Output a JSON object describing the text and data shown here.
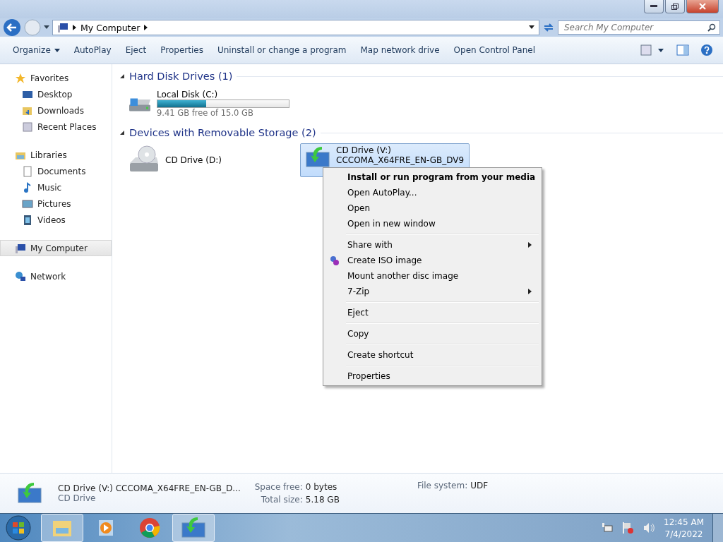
{
  "window": {
    "address": "My Computer",
    "search": {
      "placeholder": "Search My Computer"
    }
  },
  "toolbar": [
    {
      "label": "Organize",
      "dropdown": true
    },
    {
      "label": "AutoPlay",
      "dropdown": false
    },
    {
      "label": "Eject",
      "dropdown": false
    },
    {
      "label": "Properties",
      "dropdown": false
    },
    {
      "label": "Uninstall or change a program",
      "dropdown": false
    },
    {
      "label": "Map network drive",
      "dropdown": false
    },
    {
      "label": "Open Control Panel",
      "dropdown": false
    }
  ],
  "sidebar": {
    "groups": [
      {
        "label": "Favorites",
        "kind": "favorites",
        "selected": false,
        "children": [
          {
            "label": "Desktop",
            "kind": "desktop"
          },
          {
            "label": "Downloads",
            "kind": "downloads"
          },
          {
            "label": "Recent Places",
            "kind": "recent"
          }
        ]
      },
      {
        "label": "Libraries",
        "kind": "libraries",
        "selected": false,
        "children": [
          {
            "label": "Documents",
            "kind": "documents"
          },
          {
            "label": "Music",
            "kind": "music"
          },
          {
            "label": "Pictures",
            "kind": "pictures"
          },
          {
            "label": "Videos",
            "kind": "videos"
          }
        ]
      },
      {
        "label": "My Computer",
        "kind": "computer",
        "selected": true
      },
      {
        "label": "Network",
        "kind": "network",
        "selected": false
      }
    ]
  },
  "sections": [
    {
      "title": "Hard Disk Drives (1)",
      "expanded": true,
      "drives": [
        {
          "kind": "hdd",
          "name": "Local Disk (C:)",
          "level": 0.37,
          "free": "9.41 GB free of 15.0 GB",
          "selected": false
        }
      ]
    },
    {
      "title": "Devices with Removable Storage (2)",
      "expanded": true,
      "drives": [
        {
          "kind": "cd",
          "name": "CD Drive (D:)",
          "selected": false
        },
        {
          "kind": "media",
          "name": "CD Drive (V:)",
          "label": "CCCOMA_X64FRE_EN-GB_DV9",
          "selected": true
        }
      ]
    }
  ],
  "context_menu": [
    {
      "kind": "item",
      "label": "Install or run program from your media",
      "default": true,
      "submenu": false,
      "icon": false
    },
    {
      "kind": "item",
      "label": "Open AutoPlay...",
      "default": false,
      "submenu": false,
      "icon": false
    },
    {
      "kind": "item",
      "label": "Open",
      "default": false,
      "submenu": false,
      "icon": false
    },
    {
      "kind": "item",
      "label": "Open in new window",
      "default": false,
      "submenu": false,
      "icon": false
    },
    {
      "kind": "separator"
    },
    {
      "kind": "item",
      "label": "Share with",
      "default": false,
      "submenu": true,
      "icon": false
    },
    {
      "kind": "item",
      "label": "Create ISO image",
      "default": false,
      "submenu": false,
      "icon": true
    },
    {
      "kind": "item",
      "label": "Mount another disc image",
      "default": false,
      "submenu": false,
      "icon": false
    },
    {
      "kind": "item",
      "label": "7-Zip",
      "default": false,
      "submenu": true,
      "icon": false
    },
    {
      "kind": "separator"
    },
    {
      "kind": "item",
      "label": "Eject",
      "default": false,
      "submenu": false,
      "icon": false
    },
    {
      "kind": "separator"
    },
    {
      "kind": "item",
      "label": "Copy",
      "default": false,
      "submenu": false,
      "icon": false
    },
    {
      "kind": "separator"
    },
    {
      "kind": "item",
      "label": "Create shortcut",
      "default": false,
      "submenu": false,
      "icon": false
    },
    {
      "kind": "separator"
    },
    {
      "kind": "item",
      "label": "Properties",
      "default": false,
      "submenu": false,
      "icon": false
    }
  ],
  "details": {
    "title": "CD Drive (V:) CCCOMA_X64FRE_EN-GB_D...",
    "type": "CD Drive",
    "fields": [
      {
        "label": "Space free:",
        "value": "0 bytes"
      },
      {
        "label": "Total size:",
        "value": "5.18 GB"
      },
      {
        "label": "File system:",
        "value": "UDF"
      }
    ]
  },
  "taskbar": {
    "apps": [
      {
        "kind": "explorer",
        "active": true
      },
      {
        "kind": "media",
        "active": false
      },
      {
        "kind": "chrome",
        "active": false
      },
      {
        "kind": "drive",
        "active": true
      }
    ],
    "time": "12:45 AM",
    "date": "7/4/2022"
  }
}
